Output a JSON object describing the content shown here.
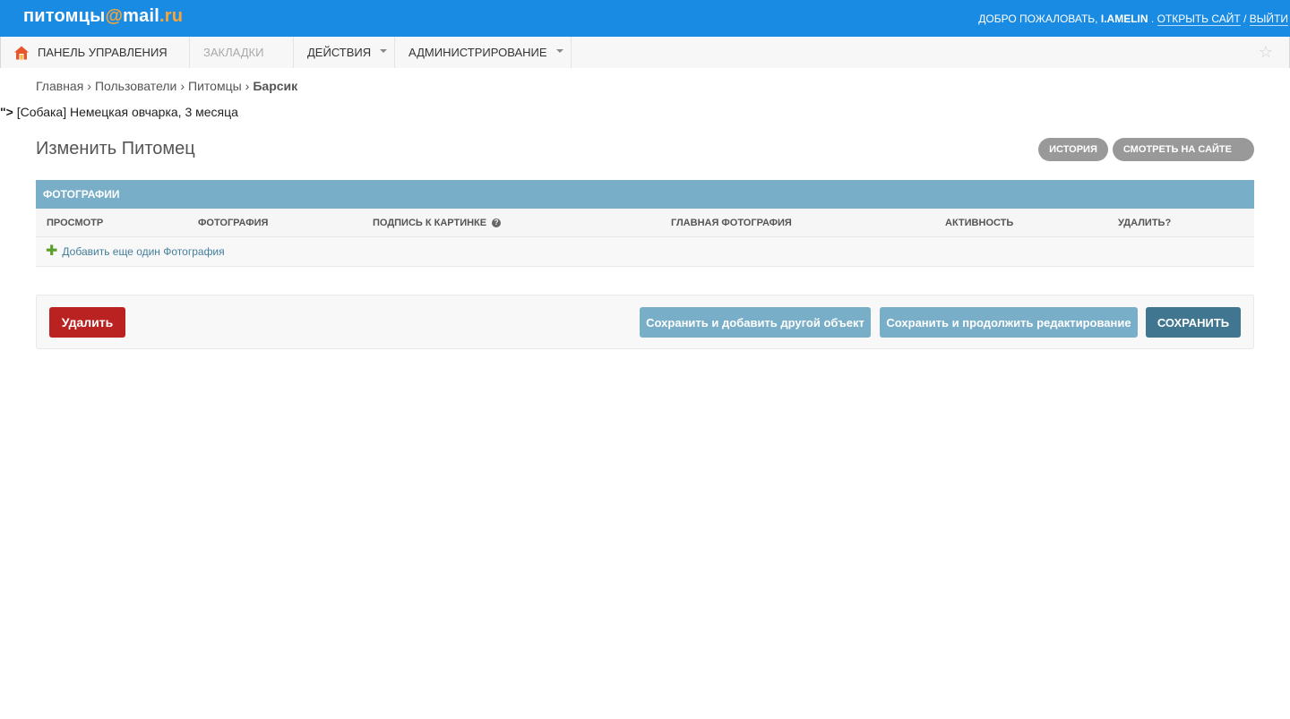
{
  "header": {
    "logo_main": "питомцы",
    "logo_at": "@",
    "logo_mail": "mail",
    "logo_ru": ".ru",
    "welcome": "ДОБРО ПОЖАЛОВАТЬ,",
    "username": "I.AMELIN",
    "dot": ".",
    "open_site": "ОТКРЫТЬ САЙТ",
    "slash": "/",
    "logout": "ВЫЙТИ"
  },
  "nav": {
    "items": [
      {
        "label": "ПАНЕЛЬ УПРАВЛЕНИЯ"
      },
      {
        "label": "ЗАКЛАДКИ"
      },
      {
        "label": "ДЕЙСТВИЯ"
      },
      {
        "label": "АДМИНИСТРИРОВАНИЕ"
      }
    ]
  },
  "breadcrumbs": {
    "items": [
      "Главная",
      "Пользователи",
      "Питомцы"
    ],
    "separator": "›",
    "current": "Барсик"
  },
  "stray_text": {
    "prefix": "\">",
    "text": " [Собака] Немецкая овчарка, 3 месяца"
  },
  "title": "Изменить Питомец",
  "object_tools": {
    "history": "ИСТОРИЯ",
    "view_on_site": "СМОТРЕТЬ НА САЙТЕ"
  },
  "inline": {
    "title": "ФОТОГРАФИИ",
    "columns": [
      "ПРОСМОТР",
      "ФОТОГРАФИЯ",
      "ПОДПИСЬ К КАРТИНКЕ",
      "ГЛАВНАЯ ФОТОГРАФИЯ",
      "АКТИВНОСТЬ",
      "УДАЛИТЬ?"
    ],
    "help_glyph": "?",
    "add_another": "Добавить еще один Фотография"
  },
  "submit": {
    "delete": "Удалить",
    "save_add": "Сохранить и добавить другой объект",
    "save_continue": "Сохранить и продолжить редактирование",
    "save": "СОХРАНИТЬ"
  },
  "colors": {
    "header_bg": "#1a8be2",
    "logo_accent": "#f7a535",
    "inline_header": "#79aec8",
    "delete_button": "#ba2121",
    "save_button": "#417690",
    "secondary_button": "#79aec8",
    "pill_bg": "#999999"
  },
  "icons": {
    "home": "home-icon",
    "star": "star-icon",
    "help": "help-icon",
    "plus": "plus-icon",
    "caret": "caret-down-icon"
  }
}
